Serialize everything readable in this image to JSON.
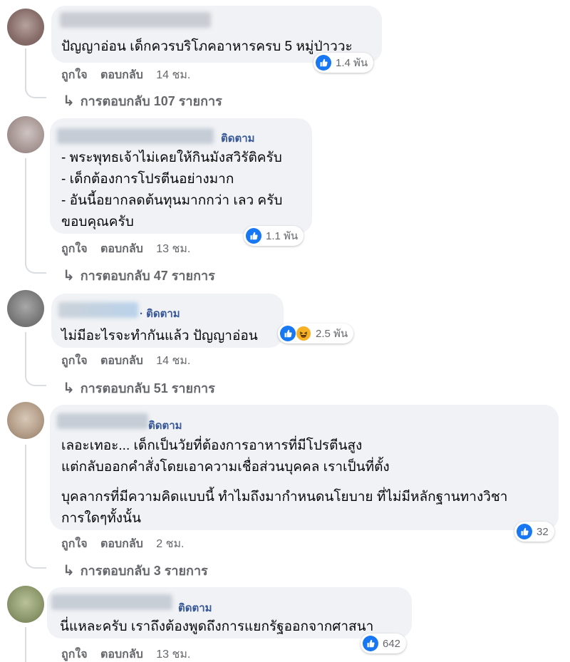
{
  "colors": {
    "link": "#385898",
    "meta": "#65676b",
    "bubble": "#f0f2f5",
    "like": "#1877f2"
  },
  "comments": [
    {
      "follow": "",
      "lines": [
        "ปัญญาอ่อน เด็กควรบริโภคอาหารครบ 5 หมู่ป่าววะ"
      ],
      "like": "ถูกใจ",
      "reply": "ตอบกลับ",
      "time": "14 ชม.",
      "reactions": {
        "icons": [
          "like-icon"
        ],
        "count": "1.4 พัน"
      },
      "replies": "การตอบกลับ 107 รายการ"
    },
    {
      "follow": "ติดตาม",
      "lines": [
        "- พระพุทธเจ้าไม่เคยให้กินมังสวิรัติครับ",
        "- เด็กต้องการโปรตีนอย่างมาก",
        "- อันนี้อยากลดต้นทุนมากกว่า เลว ครับ",
        "ขอบคุณครับ"
      ],
      "like": "ถูกใจ",
      "reply": "ตอบกลับ",
      "time": "13 ชม.",
      "reactions": {
        "icons": [
          "like-icon"
        ],
        "count": "1.1 พัน"
      },
      "replies": "การตอบกลับ 47 รายการ"
    },
    {
      "follow": "· ติดตาม",
      "lines": [
        "ไม่มีอะไรจะทำกันแล้ว ปัญญาอ่อน"
      ],
      "like": "ถูกใจ",
      "reply": "ตอบกลับ",
      "time": "14 ชม.",
      "reactions": {
        "icons": [
          "like-icon",
          "haha-icon"
        ],
        "count": "2.5 พัน"
      },
      "replies": "การตอบกลับ 51 รายการ"
    },
    {
      "follow": "ติดตาม",
      "lines": [
        "เลอะเทอะ... เด็กเป็นวัยที่ต้องการอาหารที่มีโปรตีนสูง",
        "แต่กลับออกคำสั่งโดยเอาความเชื่อส่วนบุคคล เราเป็นที่ตั้ง",
        "บุคลากรที่มีความคิดแบบนี้ ทำไมถึงมากำหนดนโยบาย ที่ไม่มีหลักฐานทางวิชา",
        "การใดๆทั้งนั้น"
      ],
      "like": "ถูกใจ",
      "reply": "ตอบกลับ",
      "time": "2 ชม.",
      "reactions": {
        "icons": [
          "like-icon"
        ],
        "count": "32"
      },
      "replies": "การตอบกลับ 3 รายการ"
    },
    {
      "follow": "ติดตาม",
      "lines": [
        "นี่แหละครับ เราถึงต้องพูดถึงการแยกรัฐออกจากศาสนา"
      ],
      "like": "ถูกใจ",
      "reply": "ตอบกลับ",
      "time": "13 ชม.",
      "reactions": {
        "icons": [
          "like-icon"
        ],
        "count": "642"
      }
    }
  ]
}
